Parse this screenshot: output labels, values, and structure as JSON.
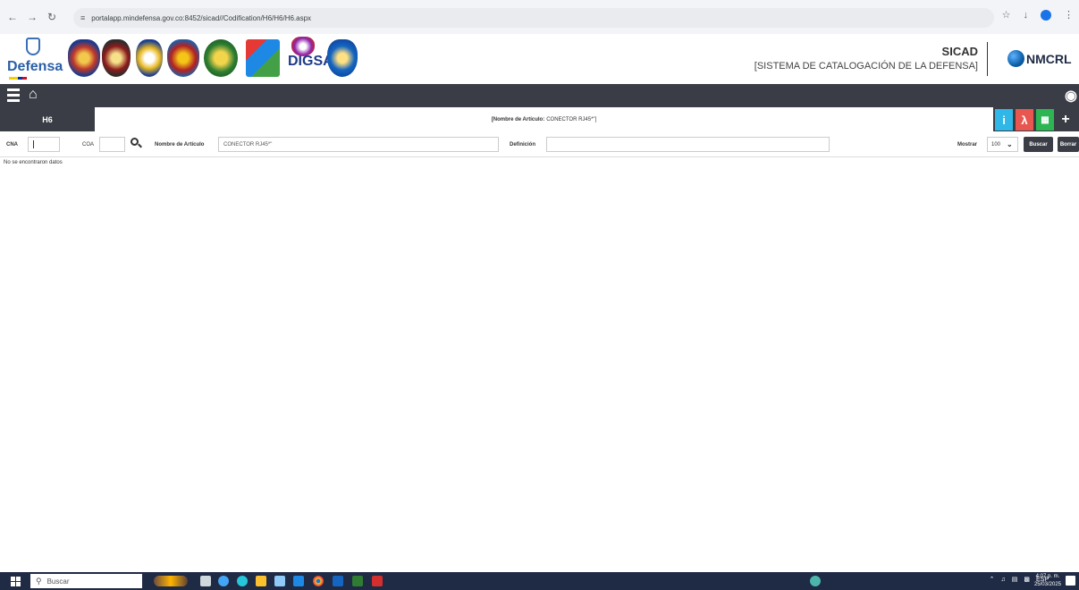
{
  "browser": {
    "url": "portalapp.mindefensa.gov.co:8452/sicad//Codification/H6/H6/H6.aspx",
    "icons": [
      "back-icon",
      "forward-icon",
      "reload-icon",
      "site-settings-icon",
      "bookmark-star-icon",
      "download-icon",
      "profile-icon",
      "menu-icon"
    ]
  },
  "header": {
    "logo_text": "Defensa",
    "partner_text": "DIGSA",
    "app_title": "SICAD",
    "app_subtitle": "[SISTEMA DE CATALOGACIÓN DE LA DEFENSA]",
    "partner_logo": "NMCRL"
  },
  "page": {
    "section_label": "H6",
    "title_prefix": "[Nombre de Artículo:",
    "title_value": "CONECTOR RJ45*\"]"
  },
  "filters": {
    "cna_label": "CNA",
    "cna_value": "",
    "coa_label": "COA",
    "coa_value": "",
    "nombre_label": "Nombre de Artículo",
    "nombre_value": "CONECTOR RJ45*\"",
    "definicion_label": "Definición",
    "definicion_value": "",
    "mostrar_label": "Mostrar",
    "mostrar_value": "100",
    "buscar_label": "Buscar",
    "borrar_label": "Borrar"
  },
  "results": {
    "empty_message": "No se encontraron datos"
  },
  "taskbar": {
    "search_placeholder": "Buscar",
    "language": "ESP",
    "time": "4:07 p. m.",
    "date": "25/03/2025"
  },
  "colors": {
    "nav_dark": "#3a3d45",
    "info": "#2fb7e8",
    "pdf": "#e8574f",
    "excel": "#2db552",
    "taskbar": "#1f2a44"
  }
}
